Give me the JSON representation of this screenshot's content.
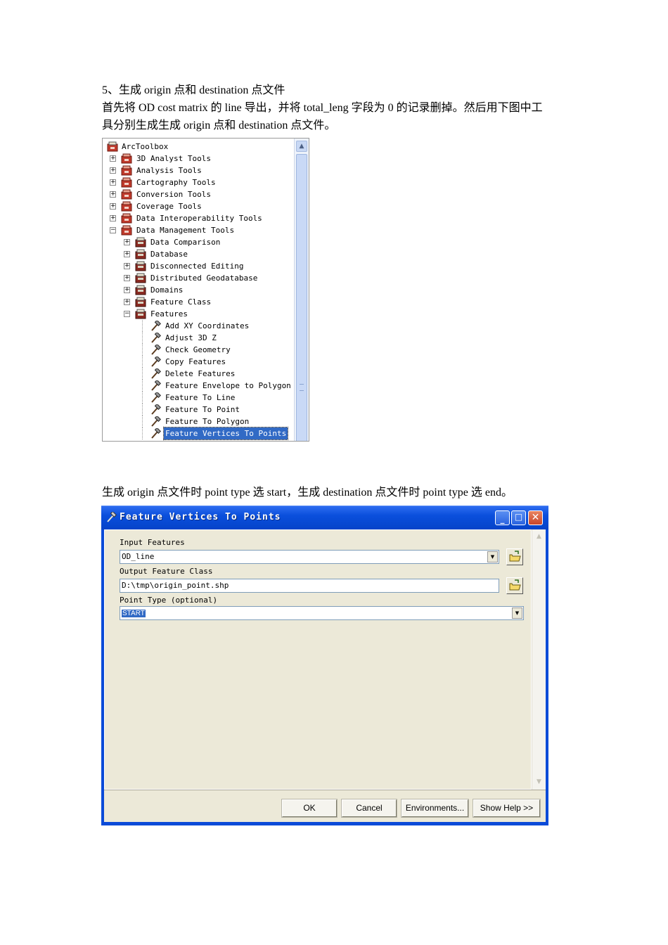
{
  "heading": "5、生成 origin 点和 destination 点文件",
  "intro_line1": "首先将 OD cost matrix 的 line 导出，并将 total_leng 字段为 0 的记录删掉。然后用下图中工",
  "intro_line2": "具分别生成生成 origin 点和 destination 点文件。",
  "toolbox": {
    "root": "ArcToolbox",
    "items": [
      {
        "label": "3D Analyst Tools",
        "level": 1,
        "kind": "toolbox",
        "expander": "+"
      },
      {
        "label": "Analysis Tools",
        "level": 1,
        "kind": "toolbox",
        "expander": "+"
      },
      {
        "label": "Cartography Tools",
        "level": 1,
        "kind": "toolbox",
        "expander": "+"
      },
      {
        "label": "Conversion Tools",
        "level": 1,
        "kind": "toolbox",
        "expander": "+"
      },
      {
        "label": "Coverage Tools",
        "level": 1,
        "kind": "toolbox",
        "expander": "+"
      },
      {
        "label": "Data Interoperability Tools",
        "level": 1,
        "kind": "toolbox",
        "expander": "+"
      },
      {
        "label": "Data Management Tools",
        "level": 1,
        "kind": "toolbox",
        "expander": "-"
      },
      {
        "label": "Data Comparison",
        "level": 2,
        "kind": "toolset",
        "expander": "+"
      },
      {
        "label": "Database",
        "level": 2,
        "kind": "toolset",
        "expander": "+"
      },
      {
        "label": "Disconnected Editing",
        "level": 2,
        "kind": "toolset",
        "expander": "+"
      },
      {
        "label": "Distributed Geodatabase",
        "level": 2,
        "kind": "toolset",
        "expander": "+"
      },
      {
        "label": "Domains",
        "level": 2,
        "kind": "toolset",
        "expander": "+"
      },
      {
        "label": "Feature Class",
        "level": 2,
        "kind": "toolset",
        "expander": "+"
      },
      {
        "label": "Features",
        "level": 2,
        "kind": "toolset",
        "expander": "-"
      },
      {
        "label": "Add XY Coordinates",
        "level": 3,
        "kind": "tool",
        "expander": ""
      },
      {
        "label": "Adjust 3D Z",
        "level": 3,
        "kind": "tool",
        "expander": ""
      },
      {
        "label": "Check Geometry",
        "level": 3,
        "kind": "tool",
        "expander": ""
      },
      {
        "label": "Copy Features",
        "level": 3,
        "kind": "tool",
        "expander": ""
      },
      {
        "label": "Delete Features",
        "level": 3,
        "kind": "tool",
        "expander": ""
      },
      {
        "label": "Feature Envelope to Polygon",
        "level": 3,
        "kind": "tool",
        "expander": ""
      },
      {
        "label": "Feature To Line",
        "level": 3,
        "kind": "tool",
        "expander": ""
      },
      {
        "label": "Feature To Point",
        "level": 3,
        "kind": "tool",
        "expander": ""
      },
      {
        "label": "Feature To Polygon",
        "level": 3,
        "kind": "tool",
        "expander": ""
      },
      {
        "label": "Feature Vertices To Points",
        "level": 3,
        "kind": "tool",
        "expander": "",
        "selected": true
      }
    ]
  },
  "note": "生成 origin 点文件时 point type 选 start，生成 destination 点文件时 point type 选 end。",
  "dialog": {
    "title": "Feature Vertices To Points",
    "input_label": "Input Features",
    "input_value": "OD_line",
    "output_label": "Output Feature Class",
    "output_value": "D:\\tmp\\origin_point.shp",
    "point_type_label": "Point Type (optional)",
    "point_type_value": "START",
    "buttons": {
      "ok": "OK",
      "cancel": "Cancel",
      "environments": "Environments...",
      "show_help": "Show Help >>"
    }
  },
  "colors": {
    "title_bar": "#0a4fdc",
    "selection": "#316ac5",
    "dialog_face": "#ece9d8"
  }
}
